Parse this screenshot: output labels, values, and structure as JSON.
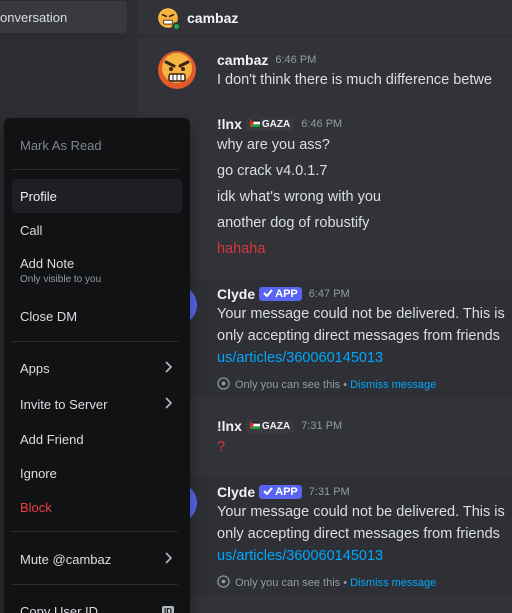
{
  "sidebar": {
    "conversation_label": "onversation"
  },
  "header": {
    "title": "cambaz"
  },
  "messages": [
    {
      "username": "cambaz",
      "time": "6:46 PM",
      "lines": [
        "I don't think there is much difference betwe"
      ]
    },
    {
      "username": "!lnx",
      "tag": "GAZA",
      "time": "6:46 PM",
      "lines": [
        "why are you ass?",
        "go crack v4.0.1.7",
        "idk what's wrong with you",
        "another dog of robustify"
      ],
      "red_line": "hahaha"
    },
    {
      "username": "Clyde",
      "app_tag": "APP",
      "time": "6:47 PM",
      "lines": [
        "Your message could not be delivered. This is",
        "only accepting direct messages from friends"
      ],
      "link": "us/articles/360060145013",
      "note": "Only you can see this •",
      "dismiss": "Dismiss message"
    },
    {
      "username": "!lnx",
      "tag": "GAZA",
      "time": "7:31 PM",
      "red_line": "?"
    },
    {
      "username": "Clyde",
      "app_tag": "APP",
      "time": "7:31 PM",
      "lines": [
        "Your message could not be delivered. This is",
        "only accepting direct messages from friends"
      ],
      "link": "us/articles/360060145013",
      "note": "Only you can see this •",
      "dismiss": "Dismiss message"
    }
  ],
  "context_menu": {
    "mark_as_read": "Mark As Read",
    "profile": "Profile",
    "call": "Call",
    "add_note": "Add Note",
    "add_note_sub": "Only visible to you",
    "close_dm": "Close DM",
    "apps": "Apps",
    "invite_to_server": "Invite to Server",
    "add_friend": "Add Friend",
    "ignore": "Ignore",
    "block": "Block",
    "mute": "Mute @cambaz",
    "copy_user_id": "Copy User ID",
    "id_badge": "ID"
  },
  "colors": {
    "accent": "#5865f2",
    "danger": "#f23f42",
    "link": "#00a8fc",
    "online": "#23a55a"
  },
  "icons": [
    "angry-face-avatar",
    "flag-icon",
    "check-icon",
    "eye-icon",
    "chevron-right-icon"
  ]
}
